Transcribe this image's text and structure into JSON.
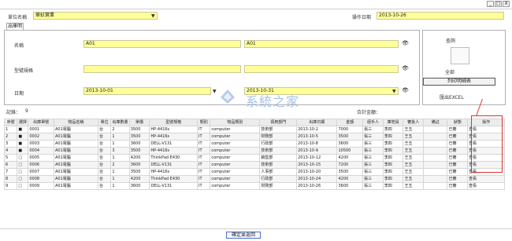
{
  "window": {
    "title": "",
    "close_glyph": "X",
    "max_glyph": "□",
    "min_glyph": "_"
  },
  "header": {
    "left_label": "單位名稱",
    "left_value": "華虹實業",
    "right_label": "操作日期",
    "right_value": "2013-10-26"
  },
  "tab": {
    "label": "出庫明細"
  },
  "fields": [
    {
      "label": "名稱",
      "v1": "A01",
      "v2": "A01"
    },
    {
      "label": "型號規格",
      "v1": "",
      "v2": ""
    },
    {
      "label": "日期",
      "v1": "2013-10-01",
      "v1b": "▼",
      "v2": "2013-10-31",
      "v2b": "▼"
    }
  ],
  "right_panel": {
    "btn1": "查詢",
    "btn2": "全部",
    "btn3": "列印明細表",
    "btn4": "匯出EXCEL",
    "link": "上一級設定"
  },
  "table_info": {
    "left": "記錄：",
    "left_val": "9",
    "right": "合計金額："
  },
  "columns": [
    "序號",
    "選擇",
    "出庫單號",
    "物品名稱",
    "單位",
    "出庫數量",
    "單價",
    "型號規格",
    "類別",
    "物品類別",
    "領用部門",
    "出庫日期",
    "金額",
    "經手人",
    "庫管員",
    "審批人",
    "備註",
    "狀態",
    "操作"
  ],
  "rows": [
    [
      "1",
      "■",
      "0001",
      "A01電腦",
      "台",
      "2",
      "3500",
      "HP-4416s",
      "IT",
      "computer",
      "技術部",
      "2013-10-2",
      "7000",
      "張三",
      "李四",
      "王五",
      "",
      "已審",
      "查看"
    ],
    [
      "2",
      "■",
      "0002",
      "A01電腦",
      "台",
      "1",
      "3500",
      "HP-4416s",
      "IT",
      "computer",
      "財務部",
      "2013-10-5",
      "3500",
      "張三",
      "李四",
      "王五",
      "",
      "已審",
      "查看"
    ],
    [
      "3",
      "■",
      "0003",
      "A01電腦",
      "台",
      "1",
      "3600",
      "DELL-V131",
      "IT",
      "computer",
      "行政部",
      "2013-10-8",
      "3600",
      "張三",
      "李四",
      "王五",
      "",
      "已審",
      "查看"
    ],
    [
      "4",
      "■",
      "0004",
      "A01電腦",
      "台",
      "3",
      "3500",
      "HP-4416s",
      "IT",
      "computer",
      "技術部",
      "2013-10-9",
      "10500",
      "張三",
      "李四",
      "王五",
      "",
      "已審",
      "查看"
    ],
    [
      "5",
      "□",
      "0005",
      "A01電腦",
      "台",
      "1",
      "4200",
      "ThinkPad E430",
      "IT",
      "computer",
      "銷售部",
      "2013-10-12",
      "4200",
      "張三",
      "李四",
      "王五",
      "",
      "已審",
      "查看"
    ],
    [
      "6",
      "□",
      "0006",
      "A01電腦",
      "台",
      "2",
      "3600",
      "DELL-V131",
      "IT",
      "computer",
      "技術部",
      "2013-10-15",
      "7200",
      "張三",
      "李四",
      "王五",
      "",
      "已審",
      "查看"
    ],
    [
      "7",
      "□",
      "0007",
      "A01電腦",
      "台",
      "1",
      "3500",
      "HP-4416s",
      "IT",
      "computer",
      "人事部",
      "2013-10-20",
      "3500",
      "張三",
      "李四",
      "王五",
      "",
      "已審",
      "查看"
    ],
    [
      "8",
      "□",
      "0008",
      "A01電腦",
      "台",
      "1",
      "4200",
      "ThinkPad E430",
      "IT",
      "computer",
      "行政部",
      "2013-10-24",
      "4200",
      "張三",
      "李四",
      "王五",
      "",
      "已審",
      "查看"
    ],
    [
      "9",
      "□",
      "0009",
      "A01電腦",
      "台",
      "1",
      "3600",
      "DELL-V131",
      "IT",
      "computer",
      "財務部",
      "2013-10-26",
      "3600",
      "張三",
      "李四",
      "王五",
      "",
      "已審",
      "查看"
    ]
  ],
  "watermark": "系統之家",
  "ok_button": "確定並返回",
  "colors": {
    "field_bg": "#ffff99",
    "highlight": "#dd3333",
    "accent": "#4a6fd0"
  }
}
